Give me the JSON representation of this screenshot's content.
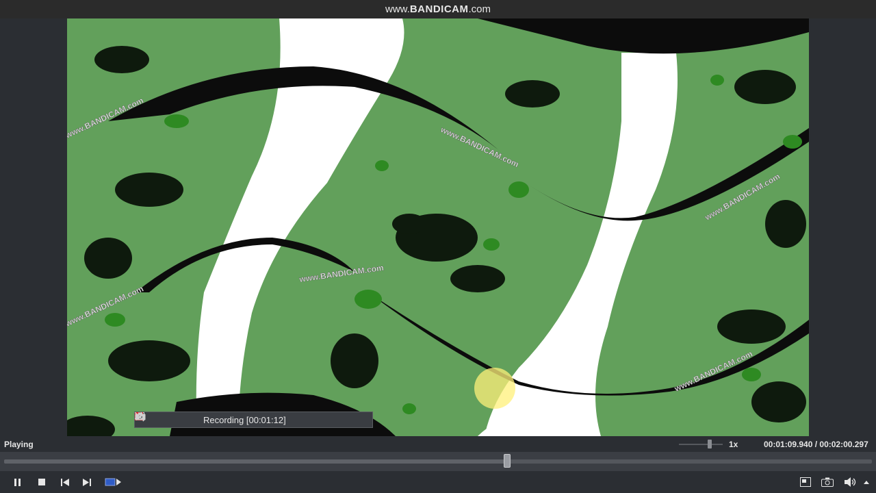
{
  "watermark": {
    "prefix": "www.",
    "brand": "BANDICAM",
    "suffix": ".com"
  },
  "video": {
    "description_colors": {
      "background": "#5f9a58",
      "stripes": "#ffffff",
      "blobs": "#0d1a0c",
      "accents": "#2f8a22"
    },
    "embedded_text": [
      "www.BANDICAM.com",
      "www.BANDICAM.com",
      "www.BANDICAM.com",
      "www.BANDICAM.com",
      "www.BANDICAM.com",
      "www.BANDICAM.com"
    ]
  },
  "recording_toolbar": {
    "label": "Recording [00:01:12]",
    "icons": [
      "menu-icon",
      "window-mode-icon",
      "search-area-icon",
      "region-icon",
      "pause-icon",
      "stop-icon",
      "camera-icon",
      "pencil-icon",
      "close-icon"
    ]
  },
  "player": {
    "status": "Playing",
    "speed": "1x",
    "time": "00:01:09.940 / 00:02:00.297",
    "progress_fraction": 0.58,
    "speed_level_fraction": 0.7,
    "controls": [
      "pause-icon",
      "stop-icon",
      "previous-icon",
      "next-icon",
      "ab-repeat-icon",
      "fullscreen-icon",
      "snapshot-icon",
      "volume-icon",
      "menu-arrow-icon"
    ]
  }
}
